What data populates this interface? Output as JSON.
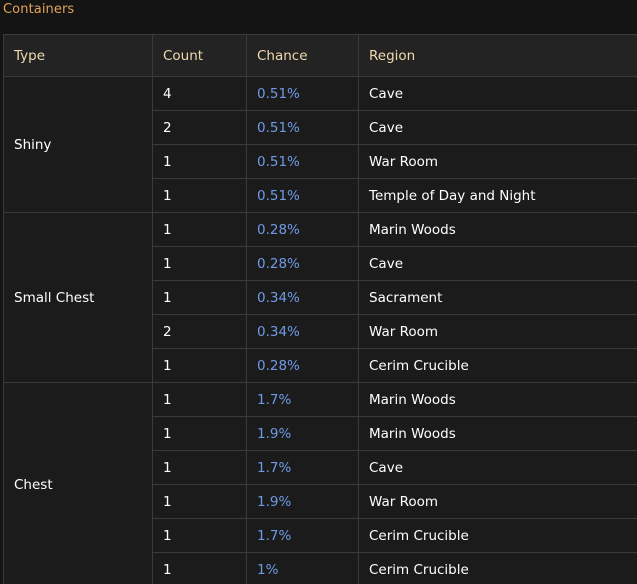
{
  "section_title": "Containers",
  "columns": {
    "type": "Type",
    "count": "Count",
    "chance": "Chance",
    "region": "Region"
  },
  "groups": [
    {
      "type": "Shiny",
      "rows": [
        {
          "count": "4",
          "chance": "0.51%",
          "region": "Cave"
        },
        {
          "count": "2",
          "chance": "0.51%",
          "region": "Cave"
        },
        {
          "count": "1",
          "chance": "0.51%",
          "region": "War Room"
        },
        {
          "count": "1",
          "chance": "0.51%",
          "region": "Temple of Day and Night"
        }
      ]
    },
    {
      "type": "Small Chest",
      "rows": [
        {
          "count": "1",
          "chance": "0.28%",
          "region": "Marin Woods"
        },
        {
          "count": "1",
          "chance": "0.28%",
          "region": "Cave"
        },
        {
          "count": "1",
          "chance": "0.34%",
          "region": "Sacrament"
        },
        {
          "count": "2",
          "chance": "0.34%",
          "region": "War Room"
        },
        {
          "count": "1",
          "chance": "0.28%",
          "region": "Cerim Crucible"
        }
      ]
    },
    {
      "type": "Chest",
      "rows": [
        {
          "count": "1",
          "chance": "1.7%",
          "region": "Marin Woods"
        },
        {
          "count": "1",
          "chance": "1.9%",
          "region": "Marin Woods"
        },
        {
          "count": "1",
          "chance": "1.7%",
          "region": "Cave"
        },
        {
          "count": "1",
          "chance": "1.9%",
          "region": "War Room"
        },
        {
          "count": "1",
          "chance": "1.7%",
          "region": "Cerim Crucible"
        },
        {
          "count": "1",
          "chance": "1%",
          "region": "Cerim Crucible"
        }
      ]
    }
  ],
  "colors": {
    "title": "#e0a35a",
    "header_text": "#f0d9ad",
    "chance_text": "#6f9be6",
    "cell_text": "#ffffff",
    "background": "#141414",
    "border": "#3a3a3a"
  }
}
